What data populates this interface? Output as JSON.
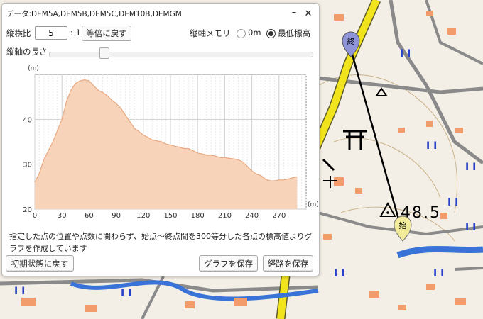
{
  "window": {
    "title": "データ:DEM5A,DEM5B,DEM5C,DEM10B,DEMGM",
    "minimize_glyph": "–",
    "close_glyph": "✕"
  },
  "controls": {
    "ratio_label": "縦横比",
    "ratio_value": "5",
    "ratio_suffix": ": 1",
    "equal_button": "等倍に戻す",
    "vertical_axis_label": "縦軸メモリ",
    "option_zero": "0m",
    "option_min": "最低標高",
    "selected_option": "最低標高",
    "axis_length_label": "縦軸の長さ",
    "axis_length_fraction": 0.2
  },
  "description": "指定した点の位置や点数に関わらず、始点～終点間を300等分した各点の標高値よりグラフを作成しています",
  "buttons": {
    "reset": "初期状態に戻す",
    "save_graph": "グラフを保存",
    "save_route": "経路を保存"
  },
  "map": {
    "marker_end": "終",
    "marker_start": "始",
    "elevation_label": "48.5",
    "colors": {
      "road_yellow": "#f2e41c",
      "river": "#3a73d8",
      "building": "#f39c6b",
      "route": "#000000"
    }
  },
  "chart_data": {
    "type": "area",
    "x_unit": "(m)",
    "y_unit": "(m)",
    "xlim": [
      0,
      300
    ],
    "ylim": [
      20,
      50
    ],
    "x_ticks": [
      0,
      30,
      60,
      90,
      120,
      150,
      180,
      210,
      240,
      270
    ],
    "y_ticks": [
      20,
      30,
      40
    ],
    "grid": true,
    "fill_color": "#f6d3b9",
    "line_color": "#e8a880",
    "x": [
      0,
      5,
      10,
      15,
      20,
      25,
      30,
      35,
      40,
      45,
      50,
      55,
      60,
      65,
      70,
      75,
      80,
      85,
      90,
      95,
      100,
      105,
      110,
      115,
      120,
      125,
      130,
      135,
      140,
      145,
      150,
      155,
      160,
      165,
      170,
      175,
      180,
      185,
      190,
      195,
      200,
      205,
      210,
      215,
      220,
      225,
      230,
      235,
      240,
      245,
      250,
      255,
      260,
      265,
      270,
      275,
      280,
      285,
      290
    ],
    "y": [
      26,
      28,
      31,
      33,
      35,
      37.5,
      40,
      44,
      46.5,
      48,
      48.6,
      48.8,
      48.6,
      47.5,
      46.5,
      46,
      45.3,
      44.3,
      43.5,
      42.5,
      41,
      39.5,
      38,
      37.3,
      36.5,
      36,
      35.4,
      35.2,
      35,
      34.5,
      34.3,
      34,
      33.8,
      33.5,
      33.5,
      33,
      32.5,
      32.3,
      32,
      32,
      31.8,
      31.5,
      31.5,
      31.3,
      31.2,
      31,
      30.5,
      29.5,
      28.5,
      27.8,
      27.5,
      26.7,
      26.3,
      26.3,
      26.5,
      26.5,
      26.7,
      27,
      27.2
    ]
  }
}
